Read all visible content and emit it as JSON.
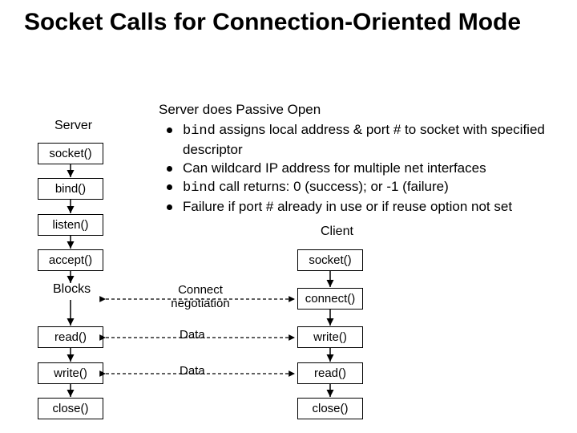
{
  "title": "Socket Calls for Connection-Oriented Mode",
  "labels": {
    "server": "Server",
    "client": "Client",
    "blocks": "Blocks"
  },
  "server_boxes": {
    "socket": "socket()",
    "bind": "bind()",
    "listen": "listen()",
    "accept": "accept()",
    "read": "read()",
    "write": "write()",
    "close": "close()"
  },
  "client_boxes": {
    "socket": "socket()",
    "connect": "connect()",
    "write": "write()",
    "read": "read()",
    "close": "close()"
  },
  "hlabels": {
    "connect": "Connect negotiation",
    "data1": "Data",
    "data2": "Data"
  },
  "bullets": {
    "heading": "Server does Passive Open",
    "b1_pre": "bind",
    "b1_rest": " assigns local address & port # to socket with specified descriptor",
    "b2": "Can wildcard IP address for multiple net interfaces",
    "b3_pre": "bind",
    "b3_rest": " call returns: 0 (success); or -1 (failure)",
    "b4": "Failure if port # already in use or if reuse option not set"
  }
}
